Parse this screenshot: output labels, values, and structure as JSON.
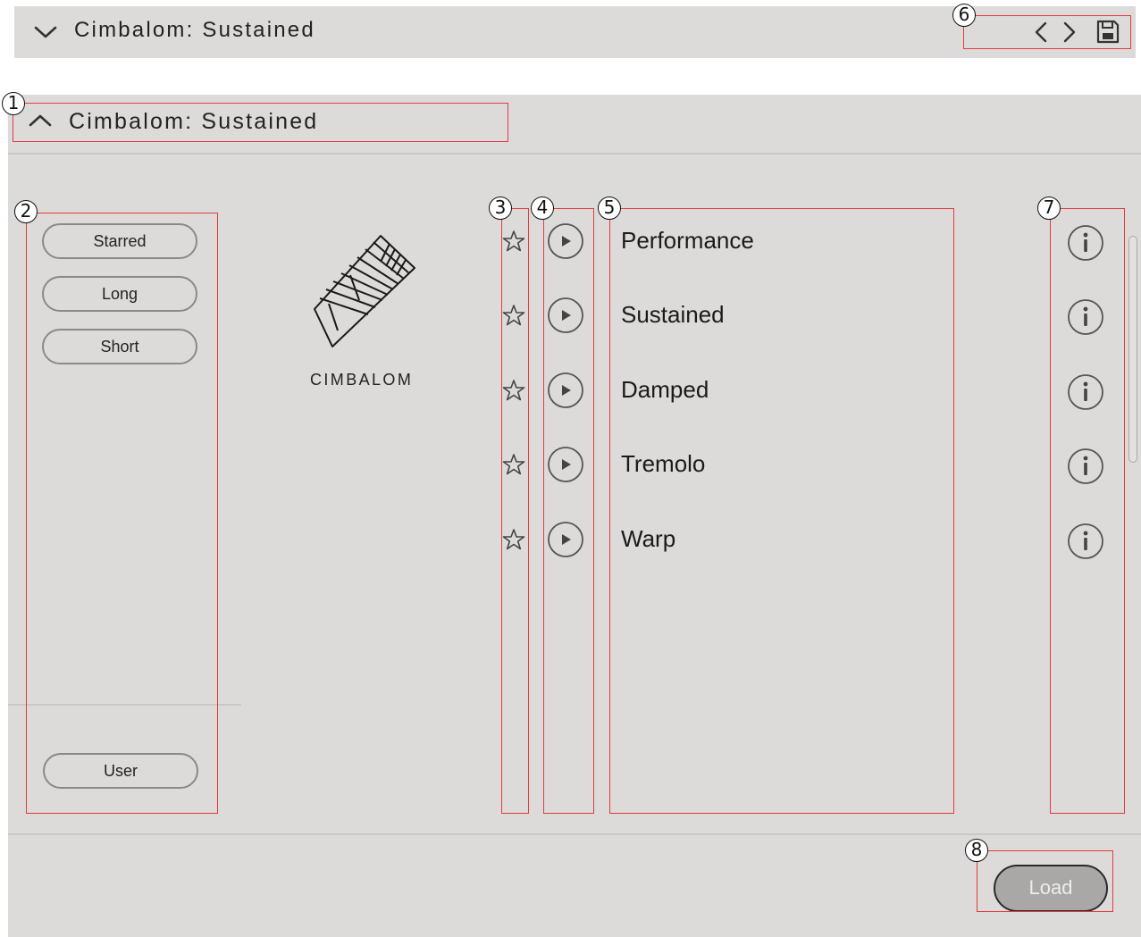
{
  "top_bar": {
    "preset_title": "Cimbalom: Sustained",
    "collapse_icon": "chevron-down-icon",
    "prev_icon": "chevron-left-icon",
    "next_icon": "chevron-right-icon",
    "save_icon": "save-icon"
  },
  "browser": {
    "header_title": "Cimbalom: Sustained",
    "expand_icon": "chevron-up-icon",
    "filters": [
      "Starred",
      "Long",
      "Short"
    ],
    "user_filter": "User",
    "instrument": {
      "name": "CIMBALOM",
      "icon": "cimbalom-icon"
    },
    "articulations": [
      {
        "name": "Performance",
        "star_icon": "star-icon",
        "play_icon": "play-icon",
        "info_icon": "info-icon"
      },
      {
        "name": "Sustained",
        "star_icon": "star-icon",
        "play_icon": "play-icon",
        "info_icon": "info-icon"
      },
      {
        "name": "Damped",
        "star_icon": "star-icon",
        "play_icon": "play-icon",
        "info_icon": "info-icon"
      },
      {
        "name": "Tremolo",
        "star_icon": "star-icon",
        "play_icon": "play-icon",
        "info_icon": "info-icon"
      },
      {
        "name": "Warp",
        "star_icon": "star-icon",
        "play_icon": "play-icon",
        "info_icon": "info-icon"
      }
    ],
    "load_label": "Load"
  },
  "callouts": [
    "1",
    "2",
    "3",
    "4",
    "5",
    "6",
    "7",
    "8"
  ],
  "colors": {
    "panel_bg": "#dcdbda",
    "callout_box": "#e23b3b",
    "load_button_bg": "#a9a8a7"
  }
}
